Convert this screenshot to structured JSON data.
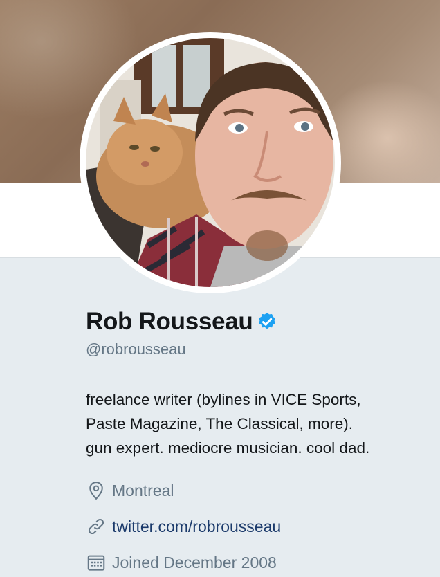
{
  "profile": {
    "name": "Rob Rousseau",
    "handle": "@robrousseau",
    "bio": "freelance writer (bylines in VICE Sports,\nPaste Magazine, The Classical, more).\ngun expert. mediocre musician. cool dad.",
    "location": "Montreal",
    "website": "twitter.com/robrousseau",
    "joined": "Joined December 2008"
  },
  "icons": {
    "verified": "verified-badge-icon",
    "location": "location-pin-icon",
    "link": "link-icon",
    "calendar": "calendar-icon"
  },
  "colors": {
    "verified": "#1da1f2",
    "muted": "#657786",
    "link": "#1b3a6b",
    "background": "#e6ecf0"
  }
}
